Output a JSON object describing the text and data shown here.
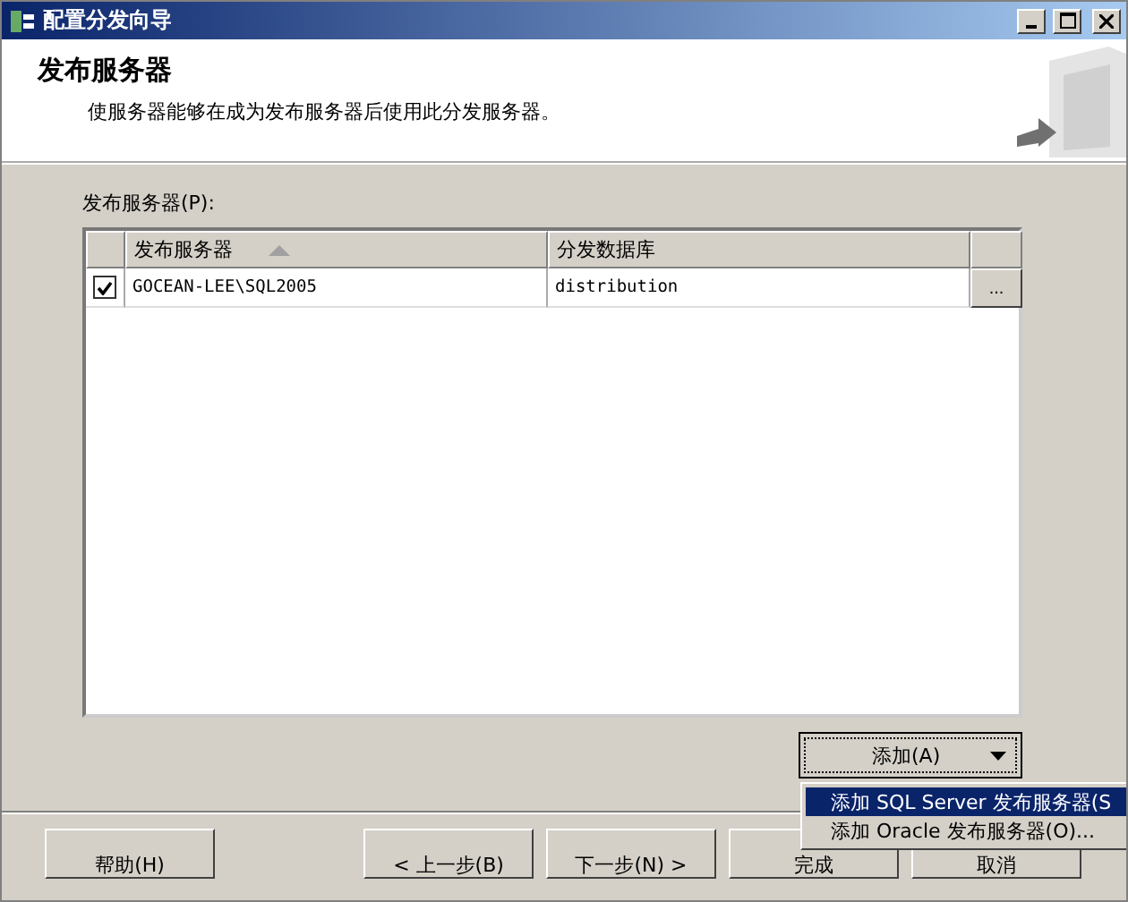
{
  "window": {
    "title": "配置分发向导"
  },
  "header": {
    "title": "发布服务器",
    "description": "使服务器能够在成为发布服务器后使用此分发服务器。"
  },
  "grid": {
    "label": "发布服务器(P):",
    "columns": [
      "发布服务器",
      "分发数据库"
    ],
    "rows": [
      {
        "checked": true,
        "server": "GOCEAN-LEE\\SQL2005",
        "database": "distribution",
        "button": "..."
      }
    ]
  },
  "add_button": {
    "label": "添加(A)"
  },
  "add_menu": [
    {
      "label": "添加 SQL Server 发布服务器(S",
      "selected": true
    },
    {
      "label": "添加 Oracle 发布服务器(O)...",
      "selected": false
    }
  ],
  "buttons": [
    "帮助(H)",
    "< 上一步(B)",
    "下一步(N) >",
    "完成",
    "取消"
  ]
}
